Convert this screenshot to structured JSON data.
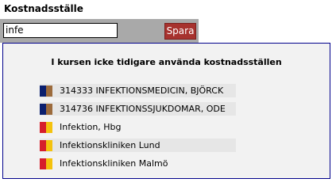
{
  "header": {
    "title": "Kostnadsställe"
  },
  "search": {
    "value": "infe",
    "save_label": "Spara"
  },
  "dropdown": {
    "heading": "I kursen icke tidigare använda kostnadsställen",
    "items": [
      {
        "label": "314333 INFEKTIONSMEDICIN, BJÖRCK",
        "icon": "region-flag-icon",
        "colors": [
          "#0b1f6e",
          "#9c6b3c"
        ],
        "highlighted": true
      },
      {
        "label": "314736 INFEKTIONSSJUKDOMAR, ODE",
        "icon": "region-flag-icon",
        "colors": [
          "#0b1f6e",
          "#9c6b3c"
        ],
        "highlighted": true
      },
      {
        "label": "Infektion, Hbg",
        "icon": "region-flag-icon",
        "colors": [
          "#d61e2b",
          "#f4c20d"
        ],
        "highlighted": false
      },
      {
        "label": "Infektionskliniken Lund",
        "icon": "region-flag-icon",
        "colors": [
          "#d61e2b",
          "#f4c20d"
        ],
        "highlighted": true
      },
      {
        "label": "Infektionskliniken Malmö",
        "icon": "region-flag-icon",
        "colors": [
          "#d61e2b",
          "#f4c20d"
        ],
        "highlighted": false
      }
    ]
  }
}
